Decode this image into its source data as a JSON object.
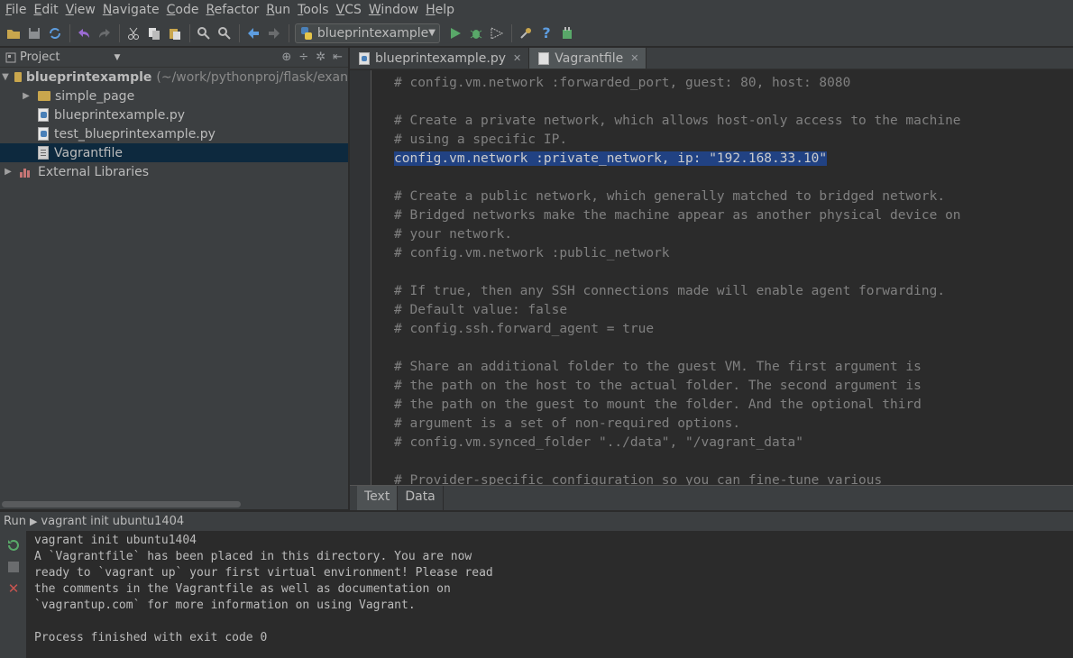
{
  "menu": [
    {
      "mnemonic": "F",
      "rest": "ile"
    },
    {
      "mnemonic": "E",
      "rest": "dit"
    },
    {
      "mnemonic": "V",
      "rest": "iew"
    },
    {
      "mnemonic": "N",
      "rest": "avigate"
    },
    {
      "mnemonic": "C",
      "rest": "ode"
    },
    {
      "mnemonic": "R",
      "rest": "efactor"
    },
    {
      "mnemonic": "R",
      "rest": "un"
    },
    {
      "mnemonic": "T",
      "rest": "ools"
    },
    {
      "mnemonic": "V",
      "rest": "CS"
    },
    {
      "mnemonic": "W",
      "rest": "indow"
    },
    {
      "mnemonic": "H",
      "rest": "elp"
    }
  ],
  "toolbar": {
    "run_config": "blueprintexample"
  },
  "project": {
    "header_title": "Project",
    "root_name": "blueprintexample",
    "root_path": "(~/work/pythonproj/flask/exan",
    "items": [
      {
        "label": "simple_page",
        "kind": "folder"
      },
      {
        "label": "blueprintexample.py",
        "kind": "py"
      },
      {
        "label": "test_blueprintexample.py",
        "kind": "py"
      },
      {
        "label": "Vagrantfile",
        "kind": "plain",
        "selected": true
      }
    ],
    "external_libraries": "External Libraries"
  },
  "editor": {
    "tabs": [
      {
        "label": "blueprintexample.py",
        "active": false
      },
      {
        "label": "Vagrantfile",
        "active": true
      }
    ],
    "lines": [
      "# config.vm.network :forwarded_port, guest: 80, host: 8080",
      "",
      "# Create a private network, which allows host-only access to the machine",
      "# using a specific IP.",
      "config.vm.network :private_network, ip: \"192.168.33.10\"",
      "",
      "# Create a public network, which generally matched to bridged network.",
      "# Bridged networks make the machine appear as another physical device on",
      "# your network.",
      "# config.vm.network :public_network",
      "",
      "# If true, then any SSH connections made will enable agent forwarding.",
      "# Default value: false",
      "# config.ssh.forward_agent = true",
      "",
      "# Share an additional folder to the guest VM. The first argument is",
      "# the path on the host to the actual folder. The second argument is",
      "# the path on the guest to mount the folder. And the optional third",
      "# argument is a set of non-required options.",
      "# config.vm.synced_folder \"../data\", \"/vagrant_data\"",
      "",
      "# Provider-specific configuration so you can fine-tune various"
    ],
    "selected_line": 4,
    "bottom_tabs": [
      {
        "label": "Text",
        "active": true
      },
      {
        "label": "Data",
        "active": false
      }
    ]
  },
  "run": {
    "prefix": "Run",
    "config": "vagrant init ubuntu1404",
    "console": [
      "vagrant init ubuntu1404",
      "A `Vagrantfile` has been placed in this directory. You are now",
      "ready to `vagrant up` your first virtual environment! Please read",
      "the comments in the Vagrantfile as well as documentation on",
      "`vagrantup.com` for more information on using Vagrant.",
      "",
      "Process finished with exit code 0"
    ]
  },
  "colors": {
    "background": "#2b2b2b",
    "panel": "#3c3f41",
    "selection": "#214283",
    "tree_selection": "#0d293e"
  }
}
